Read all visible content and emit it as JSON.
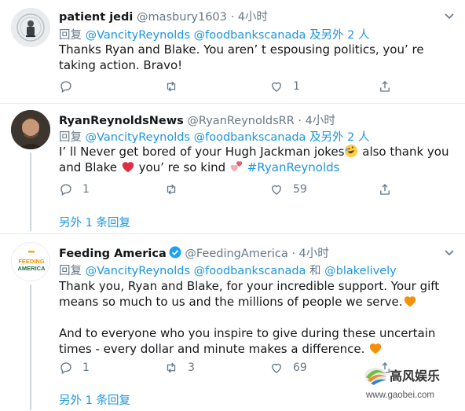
{
  "tweets": [
    {
      "name": "patient jedi",
      "handle": "@masbury1603",
      "dot": "·",
      "time": "4小时",
      "reply_prefix": "回复",
      "reply_mentions": "@VancityReynolds @foodbankscanada",
      "reply_suffix": "及另外 2 人",
      "text": "Thanks Ryan and Blake. You aren’ t espousing politics, you’ re taking action. Bravo!",
      "replies": "",
      "retweets": "",
      "likes": "1"
    },
    {
      "name": "RyanReynoldsNews",
      "handle": "@RyanReynoldsRR",
      "dot": "·",
      "time": "4小时",
      "reply_prefix": "回复",
      "reply_mentions": "@VancityReynolds @foodbankscanada",
      "reply_suffix": "及另外 2 人",
      "text_part1": "I’ ll Never get bored of your Hugh Jackman jokes",
      "text_part2": " also thank you and Blake ",
      "text_part3": " you’ re so kind ",
      "hashtag": "#RyanReynolds",
      "replies": "1",
      "retweets": "",
      "likes": "59",
      "more_replies": "另外 1 条回复"
    },
    {
      "name": "Feeding America",
      "handle": "@FeedingAmerica",
      "dot": "·",
      "time": "4小时",
      "avatar_text_1": "FEEDING",
      "avatar_text_2": "AMERICA",
      "reply_prefix": "回复",
      "reply_mentions_1": "@VancityReynolds @foodbankscanada",
      "reply_and": "和",
      "reply_mentions_2": "@blakelively",
      "text_p1": "Thank you, Ryan and Blake, for your incredible support. Your gift means so much to us and the millions of people we serve.",
      "text_p2": "And to everyone who you inspire to give during these uncertain times - every dollar and minute makes a difference. ",
      "replies": "1",
      "retweets": "3",
      "likes": "69",
      "more_replies": "另外 1 条回复"
    }
  ],
  "watermark": {
    "text": "高风娱乐",
    "url": "www.gaobei.com"
  },
  "colors": {
    "link": "#1b95e0",
    "muted": "#657786",
    "text": "#14171a",
    "heart": "#e0245e",
    "orange_heart": "#f5a623"
  }
}
